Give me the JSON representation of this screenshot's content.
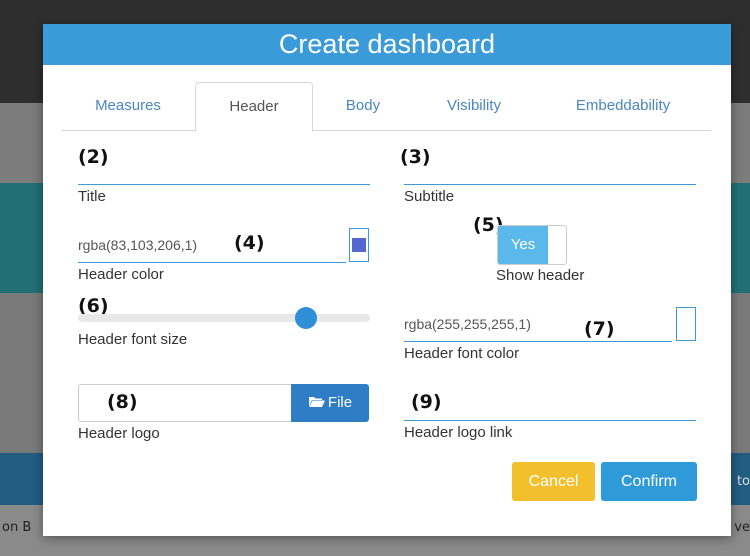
{
  "background": {
    "left_text": "on B",
    "right_text": "ve",
    "right_text2": "to"
  },
  "modal": {
    "title": "Create dashboard",
    "tabs": [
      {
        "label": "Measures",
        "active": false
      },
      {
        "label": "Header",
        "active": true
      },
      {
        "label": "Body",
        "active": false
      },
      {
        "label": "Visibility",
        "active": false
      },
      {
        "label": "Embeddability",
        "active": false
      }
    ],
    "fields": {
      "title": {
        "label": "Title",
        "value": "",
        "annotation": "(2)"
      },
      "subtitle": {
        "label": "Subtitle",
        "value": "",
        "annotation": "(3)"
      },
      "header_color": {
        "label": "Header color",
        "value": "rgba(83,103,206,1)",
        "annotation": "(4)",
        "swatch": "#5367ce"
      },
      "show_header": {
        "label": "Show header",
        "toggle_label": "Yes",
        "checked": true,
        "annotation": "(5)"
      },
      "header_font_size": {
        "label": "Header font size",
        "annotation": "(6)",
        "level": 0.78
      },
      "header_font_color": {
        "label": "Header font color",
        "value": "rgba(255,255,255,1)",
        "annotation": "(7)",
        "swatch": "#ffffff"
      },
      "header_logo": {
        "label": "Header logo",
        "button_label": "File",
        "annotation": "(8)"
      },
      "header_logo_link": {
        "label": "Header logo link",
        "value": "",
        "annotation": "(9)"
      }
    },
    "buttons": {
      "cancel": "Cancel",
      "confirm": "Confirm"
    }
  },
  "colors": {
    "header_bg": "#3a9bd8",
    "accent": "#2f9ad8",
    "cancel": "#f2c02c"
  }
}
